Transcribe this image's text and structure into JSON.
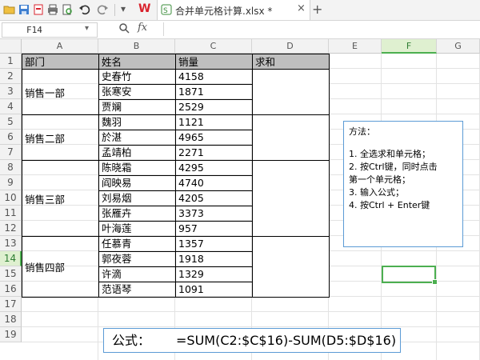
{
  "toolbar": {
    "tab_title": "合并单元格计算.xlsx *",
    "close_glyph": "×",
    "add_glyph": "+",
    "dropdown_glyph": "▾",
    "wps_logo": "W",
    "icons": [
      "folder-icon",
      "save-icon",
      "export-pdf-icon",
      "print-icon",
      "print-preview-icon",
      "undo-icon",
      "redo-icon",
      "customize-icon"
    ]
  },
  "formula_bar": {
    "name_box": "F14",
    "name_box_arrow": "▾",
    "zoom_glyph": "🔍",
    "fx_label": "fx",
    "formula": ""
  },
  "columns": [
    "A",
    "B",
    "C",
    "D",
    "E",
    "F",
    "G"
  ],
  "active_column": "F",
  "rows": [
    "1",
    "2",
    "3",
    "4",
    "5",
    "6",
    "7",
    "8",
    "9",
    "10",
    "11",
    "12",
    "13",
    "14",
    "15",
    "16",
    "17",
    "18",
    "19"
  ],
  "active_row": "14",
  "table": {
    "headers": [
      "部门",
      "姓名",
      "销量",
      "求和"
    ],
    "departments": [
      "销售一部",
      "销售二部",
      "销售三部",
      "销售四部"
    ],
    "names": [
      "史春竹",
      "张寒安",
      "贾斓",
      "魏羽",
      "於湛",
      "孟靖柏",
      "陈晓霜",
      "阎映易",
      "刘易烟",
      "张雁卉",
      "叶海莲",
      "任慕青",
      "郭夜蓉",
      "许滴",
      "范语琴"
    ],
    "sales": [
      "4158",
      "1871",
      "2529",
      "1121",
      "4965",
      "2271",
      "4295",
      "4740",
      "4205",
      "3373",
      "957",
      "1357",
      "1918",
      "1329",
      "1091"
    ]
  },
  "note": {
    "title": "方法：",
    "lines": [
      "1. 全选求和单元格；",
      "2. 按Ctrl键，同时点击",
      "第一个单元格；",
      "3. 输入公式；",
      "4. 按Ctrl + Enter键"
    ]
  },
  "formula_box": {
    "label": "公式：",
    "expression": "=SUM(C2:$C$16)-SUM(D5:$D$16)"
  },
  "colors": {
    "header_fill": "#bfbfbf",
    "selection": "#4caf50",
    "textbox_border": "#5b9bd5",
    "wps_red": "#d9232d"
  }
}
